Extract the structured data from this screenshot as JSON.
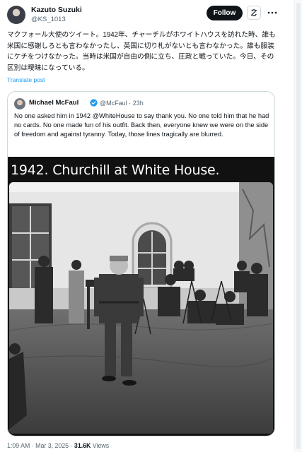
{
  "author": {
    "name": "Kazuto Suzuki",
    "handle": "@KS_1013"
  },
  "actions": {
    "follow_label": "Follow",
    "grok_icon": "grok-icon",
    "more_icon": "more-icon"
  },
  "tweet": {
    "text": "マクフォール大使のツイート。1942年、チャーチルがホワイトハウスを訪れた時、誰も米国に感謝しろとも言わなかったし、英国に切り札がないとも言わなかった。誰も服装にケチをつけなかった。当時は米国が自由の側に立ち、圧政と戦っていた。今日、その区別は曖昧になっている。",
    "translate_label": "Translate post"
  },
  "quote": {
    "name": "Michael McFaul",
    "handle": "@McFaul",
    "separator": "·",
    "time": "23h",
    "text": "No one asked him in 1942 @WhiteHouse to say thank you. No one told him that he had no cards. No one made fun of his outfit. Back then, everyone knew we were on the side of freedom and against tyranny.  Today, those lines tragically are blurred.",
    "media_caption": "1942. Churchill at White House.",
    "verified_icon": "verified-badge-icon"
  },
  "meta": {
    "time": "1:09 AM",
    "date": "Mar 3, 2025",
    "views_count": "31.6K",
    "views_label": "Views",
    "sep": "·"
  },
  "colors": {
    "link": "#1d9bf0",
    "secondary_text": "#536471",
    "border": "#cfd9de"
  }
}
